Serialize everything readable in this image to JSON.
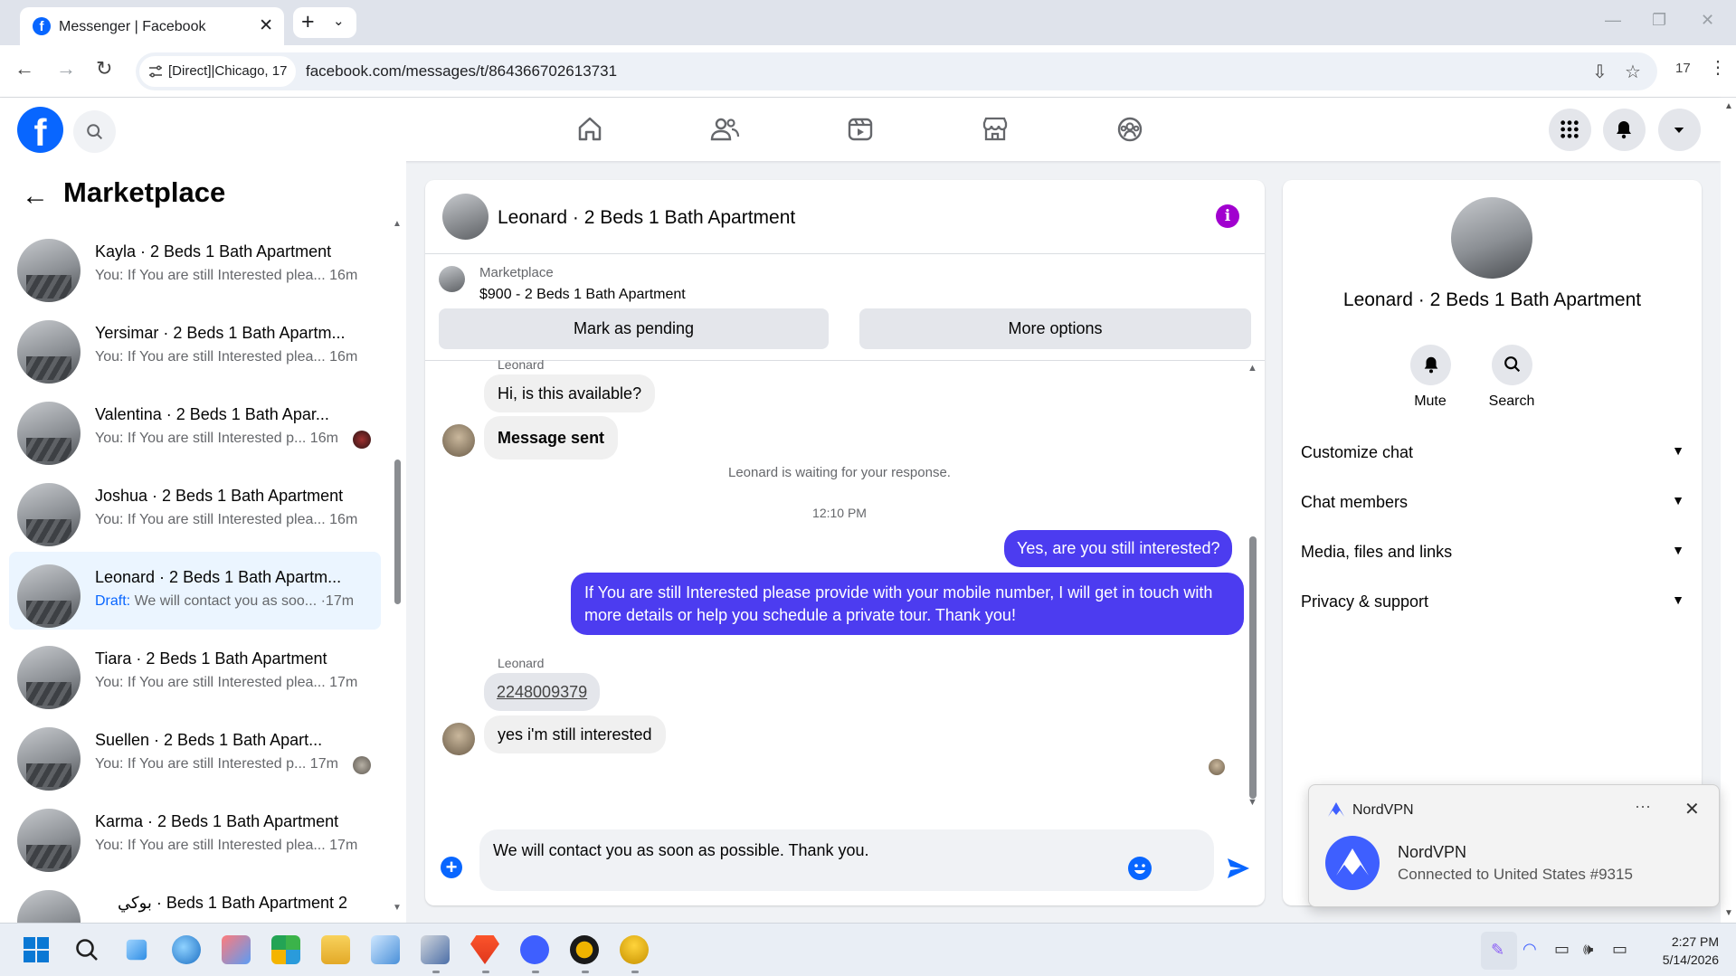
{
  "browser": {
    "tab_title": "Messenger | Facebook",
    "site_chip": "[Direct]|Chicago, 17",
    "url": "facebook.com/messages/t/864366702613731",
    "ext_badge": "17"
  },
  "left_pane": {
    "title": "Marketplace",
    "conversations": [
      {
        "name": "Kayla · 2 Beds 1 Bath Apartment",
        "preview": "You: If You are still Interested plea... 16m"
      },
      {
        "name": "Yersimar · 2 Beds 1 Bath Apartm...",
        "preview": "You: If You are still Interested plea... 16m"
      },
      {
        "name": "Valentina · 2 Beds 1 Bath Apar...",
        "preview": "You: If You are still Interested p... 16m"
      },
      {
        "name": "Joshua · 2 Beds 1 Bath Apartment",
        "preview": "You: If You are still Interested plea... 16m"
      },
      {
        "name": "Leonard · 2 Beds 1 Bath Apartm...",
        "draft_label": "Draft:",
        "preview": " We will contact you as soo... ·17m"
      },
      {
        "name": "Tiara · 2 Beds 1 Bath Apartment",
        "preview": "You: If You are still Interested plea... 17m"
      },
      {
        "name": "Suellen · 2 Beds 1 Bath Apart...",
        "preview": "You: If You are still Interested p... 17m"
      },
      {
        "name": "Karma · 2 Beds 1 Bath Apartment",
        "preview": "You: If You are still Interested plea... 17m"
      },
      {
        "name": "بوكي · Beds 1 Bath Apartment 2",
        "preview": ""
      }
    ]
  },
  "chat": {
    "header_name": "Leonard · 2 Beds 1 Bath Apartment",
    "marketplace_label": "Marketplace",
    "listing": "$900 - 2 Beds 1 Bath Apartment",
    "mark_pending": "Mark as pending",
    "more_options": "More options",
    "sender_top": "Leonard",
    "msg1": "Hi, is this available?",
    "msg2": "Message sent",
    "waiting": "Leonard is waiting for your response.",
    "time": "12:10 PM",
    "out1": "Yes, are you still interested?",
    "out2": "If You are still Interested please provide with your mobile number, I will get in touch with more details or help you schedule a private tour. Thank you!",
    "sender_bottom": "Leonard",
    "msg3": "2248009379",
    "msg4": "yes i'm still interested",
    "composer_text": "We will contact you as soon as possible. Thank you."
  },
  "info_panel": {
    "name": "Leonard · 2 Beds 1 Bath Apartment",
    "mute": "Mute",
    "search": "Search",
    "sections": [
      "Customize chat",
      "Chat members",
      "Media, files and links",
      "Privacy & support"
    ]
  },
  "toast": {
    "app": "NordVPN",
    "title": "NordVPN",
    "body": "Connected to United States #9315"
  },
  "taskbar": {
    "time": "2:27 PM",
    "date": "5/14/2026"
  },
  "colors": {
    "brand": "#0866ff",
    "outgoing_bubble": "#4c3cf0",
    "info_purple": "#a100cf"
  }
}
